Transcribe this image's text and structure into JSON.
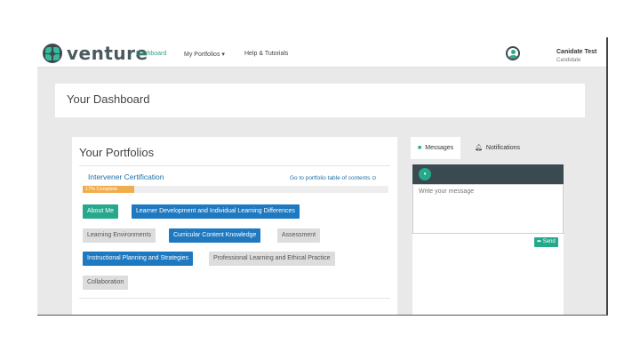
{
  "brand": {
    "name": "venture"
  },
  "nav": {
    "dashboard": "Dashboard",
    "my_portfolios": "My Portfolios ▾",
    "help": "Help & Tutorials"
  },
  "user": {
    "name": "Canidate Test",
    "role": "Candidate"
  },
  "dashboard": {
    "title": "Your Dashboard"
  },
  "portfolios": {
    "title": "Your Portfolios",
    "certification": "Intervener Certification",
    "toc_link": "Go to portfolio table of contents ⊙",
    "progress": {
      "label": "17% Complete",
      "percent": 17
    },
    "chips": [
      {
        "label": "About Me",
        "state": "complete"
      },
      {
        "label": "Learner Development and Individual Learning Differences",
        "state": "in-progress"
      },
      {
        "label": "Learning Environments",
        "state": "not-started"
      },
      {
        "label": "Curricular Content Knowledge",
        "state": "in-progress"
      },
      {
        "label": "Assessment",
        "state": "not-started"
      },
      {
        "label": "Instructional Planning and Strategies",
        "state": "in-progress"
      },
      {
        "label": "Professional Learning and Ethical Practice",
        "state": "not-started"
      },
      {
        "label": "Collaboration",
        "state": "not-started"
      }
    ]
  },
  "side": {
    "tabs": {
      "messages": "Messages",
      "notifications": "Notifications"
    },
    "message_placeholder": "Write your message",
    "send_label": "Send"
  },
  "colors": {
    "teal": "#26a88c",
    "blue": "#1f79c0",
    "gray": "#dddddd",
    "progress": "#f0ad4e",
    "header": "#3b4a4e"
  },
  "icons": [
    "logo-icon",
    "user-avatar-icon",
    "chat-icon",
    "bell-icon",
    "user-add-icon",
    "send-icon"
  ]
}
